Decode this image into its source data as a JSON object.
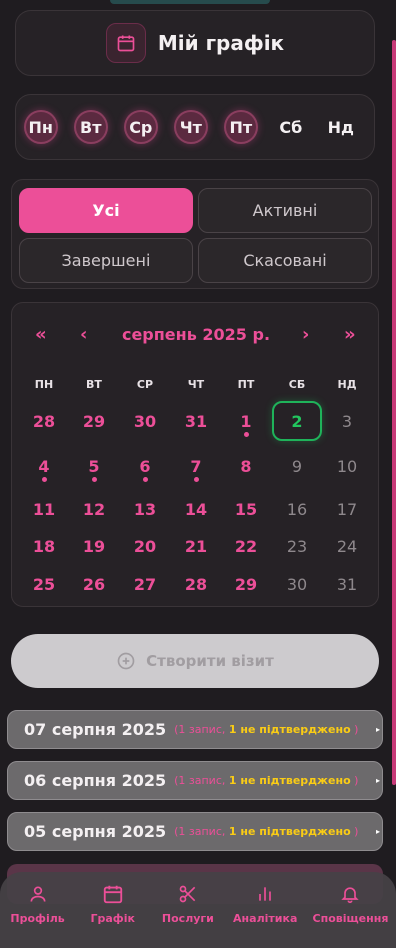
{
  "header": {
    "title": "Мій графік",
    "icon": "calendar-icon"
  },
  "weekdays": [
    {
      "label": "Пн",
      "active": true
    },
    {
      "label": "Вт",
      "active": true
    },
    {
      "label": "Ср",
      "active": true
    },
    {
      "label": "Чт",
      "active": true
    },
    {
      "label": "Пт",
      "active": true
    },
    {
      "label": "Сб",
      "active": false
    },
    {
      "label": "Нд",
      "active": false
    }
  ],
  "filters": {
    "all": "Усі",
    "active": "Активні",
    "completed": "Завершені",
    "cancelled": "Скасовані"
  },
  "calendar": {
    "prev_year": "«",
    "prev_month": "‹",
    "month": "серпень 2025 р.",
    "next_month": "›",
    "next_year": "»",
    "weekday_headers": [
      "ПН",
      "ВТ",
      "СР",
      "ЧТ",
      "ПТ",
      "СБ",
      "НД"
    ],
    "weeks": [
      [
        {
          "d": "28"
        },
        {
          "d": "29"
        },
        {
          "d": "30"
        },
        {
          "d": "31"
        },
        {
          "d": "1",
          "dot": true
        },
        {
          "d": "2",
          "today": true
        },
        {
          "d": "3",
          "weekend": true
        }
      ],
      [
        {
          "d": "4",
          "dot": true
        },
        {
          "d": "5",
          "dot": true
        },
        {
          "d": "6",
          "dot": true
        },
        {
          "d": "7",
          "dot": true
        },
        {
          "d": "8"
        },
        {
          "d": "9",
          "weekend": true
        },
        {
          "d": "10",
          "weekend": true
        }
      ],
      [
        {
          "d": "11"
        },
        {
          "d": "12"
        },
        {
          "d": "13"
        },
        {
          "d": "14"
        },
        {
          "d": "15"
        },
        {
          "d": "16",
          "weekend": true
        },
        {
          "d": "17",
          "weekend": true
        }
      ],
      [
        {
          "d": "18"
        },
        {
          "d": "19"
        },
        {
          "d": "20"
        },
        {
          "d": "21"
        },
        {
          "d": "22"
        },
        {
          "d": "23",
          "weekend": true
        },
        {
          "d": "24",
          "weekend": true
        }
      ],
      [
        {
          "d": "25"
        },
        {
          "d": "26"
        },
        {
          "d": "27"
        },
        {
          "d": "28"
        },
        {
          "d": "29"
        },
        {
          "d": "30",
          "weekend": true
        },
        {
          "d": "31",
          "weekend": true
        }
      ]
    ]
  },
  "create_visit": {
    "label": "Створити візит",
    "icon": "plus-circle-icon"
  },
  "visits": [
    {
      "date": "07 серпня 2025",
      "count": "(1 запис,",
      "unconfirmed": "1 не підтверджено",
      "close": ")",
      "arrow": "▸"
    },
    {
      "date": "06 серпня 2025",
      "count": "(1 запис,",
      "unconfirmed": "1 не підтверджено",
      "close": ")",
      "arrow": "▸"
    },
    {
      "date": "05 серпня 2025",
      "count": "(1 запис,",
      "unconfirmed": "1 не підтверджено",
      "close": ")",
      "arrow": "▸"
    }
  ],
  "nav": [
    {
      "label": "Профіль",
      "icon": "user-icon"
    },
    {
      "label": "Графік",
      "icon": "calendar-icon"
    },
    {
      "label": "Послуги",
      "icon": "scissors-icon"
    },
    {
      "label": "Аналітика",
      "icon": "bar-chart-icon"
    },
    {
      "label": "Сповіщення",
      "icon": "bell-icon"
    }
  ],
  "colors": {
    "accent": "#ec4f98",
    "today": "#22c55e",
    "warning": "#facc15"
  }
}
